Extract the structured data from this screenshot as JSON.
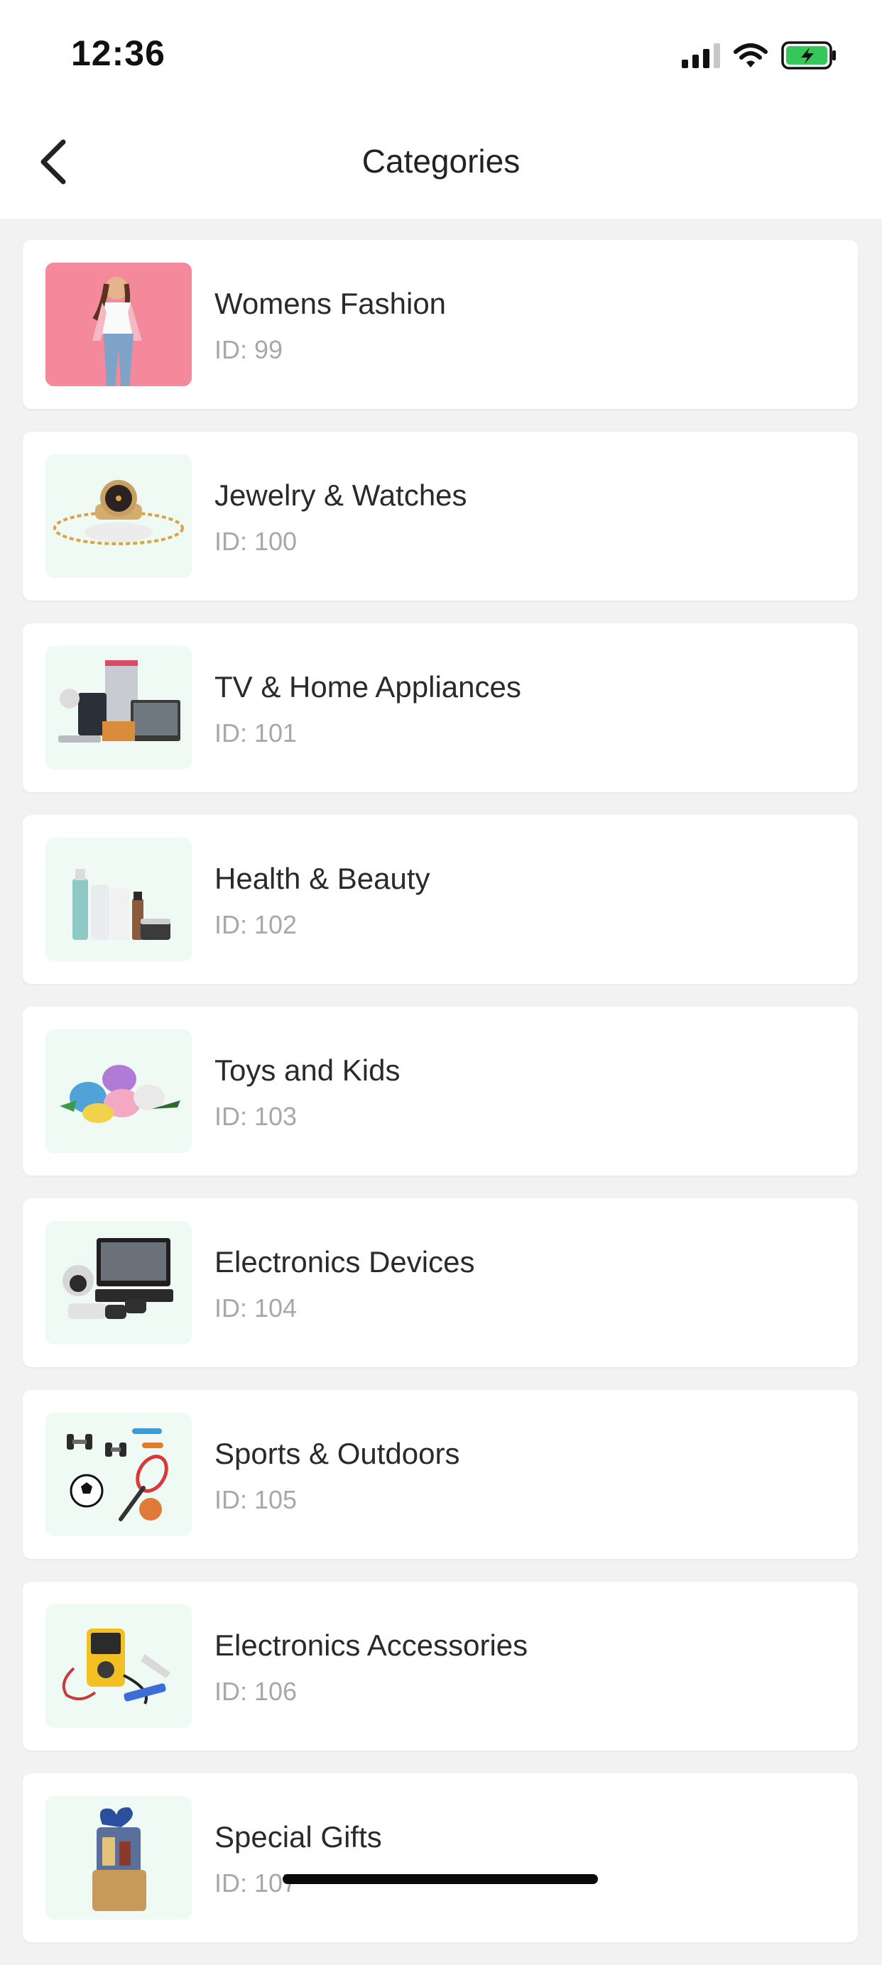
{
  "status_bar": {
    "time": "12:36"
  },
  "nav": {
    "title": "Categories"
  },
  "categories": [
    {
      "name": "Womens Fashion",
      "id_label": "ID: 99",
      "image_icon": "woman-fashion-photo"
    },
    {
      "name": "Jewelry & Watches",
      "id_label": "ID: 100",
      "image_icon": "watch-and-necklace"
    },
    {
      "name": "TV & Home Appliances",
      "id_label": "ID: 101",
      "image_icon": "appliances"
    },
    {
      "name": "Health & Beauty",
      "id_label": "ID: 102",
      "image_icon": "cosmetic-bottles"
    },
    {
      "name": "Toys and Kids",
      "id_label": "ID: 103",
      "image_icon": "plush-toys"
    },
    {
      "name": "Electronics Devices",
      "id_label": "ID: 104",
      "image_icon": "cctv-cameras"
    },
    {
      "name": "Sports & Outdoors",
      "id_label": "ID: 105",
      "image_icon": "sports-gear"
    },
    {
      "name": "Electronics Accessories",
      "id_label": "ID: 106",
      "image_icon": "multimeter-tools"
    },
    {
      "name": "Special Gifts",
      "id_label": "ID: 107",
      "image_icon": "gift-basket"
    }
  ],
  "colors": {
    "background": "#f2f2f2",
    "card": "#ffffff",
    "thumb_background": "#f0faf5",
    "battery_green": "#35c759"
  }
}
